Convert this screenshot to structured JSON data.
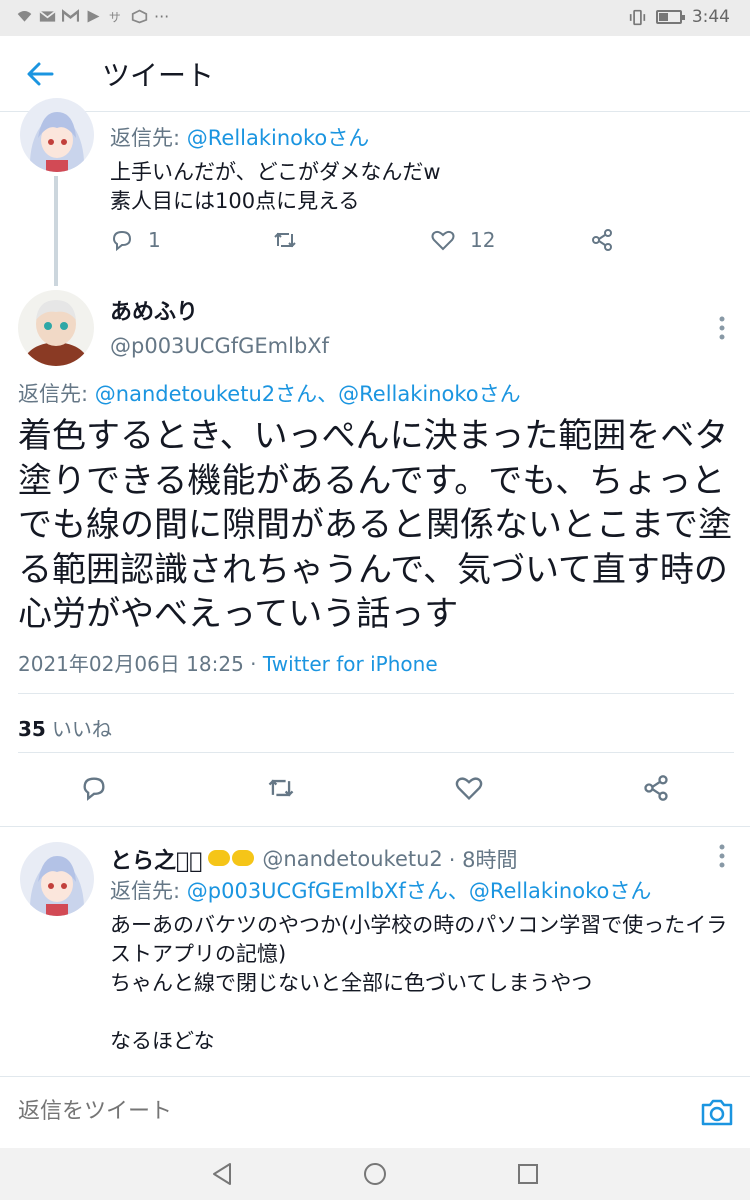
{
  "status_bar": {
    "time": "3:44"
  },
  "header": {
    "title": "ツイート"
  },
  "tweet1": {
    "reply_to_label": "返信先: ",
    "reply_to_handle": "@Rellakinokoさん",
    "body_line1": "上手いんだが、どこがダメなんだw",
    "body_line2": "素人目には100点に見える",
    "reply_count": "1",
    "like_count": "12"
  },
  "main_tweet": {
    "name": "あめふり",
    "handle": "@p003UCGfGEmlbXf",
    "reply_to_label": "返信先: ",
    "reply_to_handles": "@nandetouketu2さん、@Rellakinokoさん",
    "text": "着色するとき、いっぺんに決まった範囲をベタ塗りできる機能があるんです。でも、ちょっとでも線の間に隙間があると関係ないとこまで塗る範囲認識されちゃうんで、気づいて直す時の心労がやべえっていう話っす",
    "timestamp": "2021年02月06日 18:25 · ",
    "source": "Twitter for iPhone",
    "likes_count": "35",
    "likes_label": "いいね"
  },
  "tweet3": {
    "name": "とら之助ᷦ",
    "handle": "@nandetouketu2",
    "time": "· 8時間",
    "reply_to_label": "返信先: ",
    "reply_to_handles": "@p003UCGfGEmlbXfさん、@Rellakinokoさん",
    "body": "あーあのバケツのやつか(小学校の時のパソコン学習で使ったイラストアプリの記憶)\nちゃんと線で閉じないと全部に色づいてしまうやつ\n\nなるほどな"
  },
  "reply_bar": {
    "placeholder": "返信をツイート"
  },
  "colors": {
    "link": "#1b95e0",
    "secondary": "#657786",
    "divider": "#e1e8ed"
  }
}
